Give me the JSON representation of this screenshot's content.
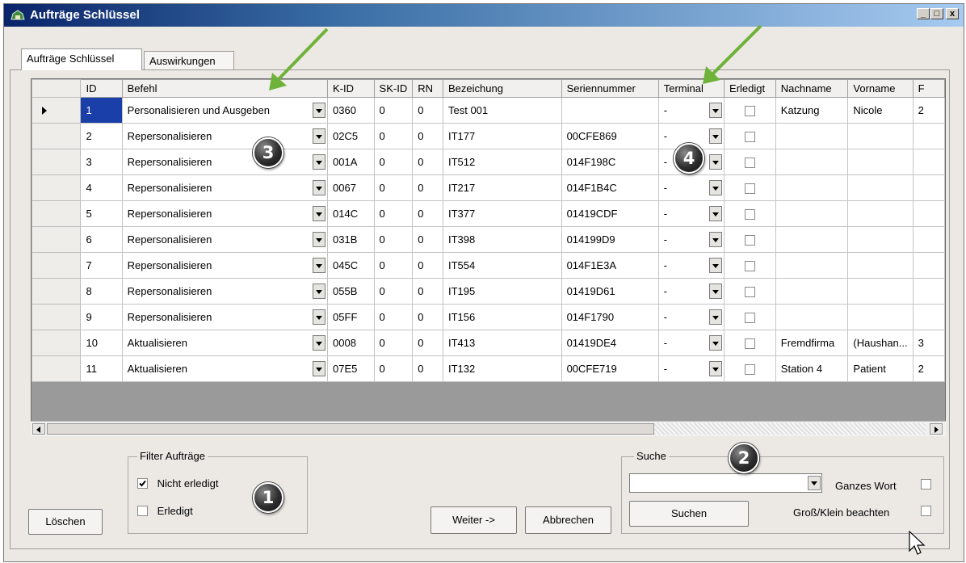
{
  "window": {
    "title": "Aufträge Schlüssel",
    "controls": {
      "minimize": "_",
      "maximize": "□",
      "close": "x"
    }
  },
  "tabs": [
    {
      "label": "Aufträge Schlüssel",
      "active": true
    },
    {
      "label": "Auswirkungen",
      "active": false
    }
  ],
  "grid": {
    "columns": [
      "ID",
      "Befehl",
      "K-ID",
      "SK-ID",
      "RN",
      "Bezeichung",
      "Seriennummer",
      "Terminal",
      "Erledigt",
      "Nachname",
      "Vorname",
      "F"
    ],
    "rows": [
      {
        "id": "1",
        "befehl": "Personalisieren und Ausgeben",
        "kid": "0360",
        "skid": "0",
        "rn": "0",
        "bez": "Test 001",
        "serial": "",
        "terminal": "-",
        "erledigt": false,
        "nachname": "Katzung",
        "vorname": "Nicole",
        "f": "2",
        "current": true
      },
      {
        "id": "2",
        "befehl": "Repersonalisieren",
        "kid": "02C5",
        "skid": "0",
        "rn": "0",
        "bez": "IT177",
        "serial": "00CFE869",
        "terminal": "-",
        "erledigt": false,
        "nachname": "",
        "vorname": "",
        "f": ""
      },
      {
        "id": "3",
        "befehl": "Repersonalisieren",
        "kid": "001A",
        "skid": "0",
        "rn": "0",
        "bez": "IT512",
        "serial": "014F198C",
        "terminal": "-",
        "erledigt": false,
        "nachname": "",
        "vorname": "",
        "f": ""
      },
      {
        "id": "4",
        "befehl": "Repersonalisieren",
        "kid": "0067",
        "skid": "0",
        "rn": "0",
        "bez": "IT217",
        "serial": "014F1B4C",
        "terminal": "-",
        "erledigt": false,
        "nachname": "",
        "vorname": "",
        "f": ""
      },
      {
        "id": "5",
        "befehl": "Repersonalisieren",
        "kid": "014C",
        "skid": "0",
        "rn": "0",
        "bez": "IT377",
        "serial": "01419CDF",
        "terminal": "-",
        "erledigt": false,
        "nachname": "",
        "vorname": "",
        "f": ""
      },
      {
        "id": "6",
        "befehl": "Repersonalisieren",
        "kid": "031B",
        "skid": "0",
        "rn": "0",
        "bez": "IT398",
        "serial": "014199D9",
        "terminal": "-",
        "erledigt": false,
        "nachname": "",
        "vorname": "",
        "f": ""
      },
      {
        "id": "7",
        "befehl": "Repersonalisieren",
        "kid": "045C",
        "skid": "0",
        "rn": "0",
        "bez": "IT554",
        "serial": "014F1E3A",
        "terminal": "-",
        "erledigt": false,
        "nachname": "",
        "vorname": "",
        "f": ""
      },
      {
        "id": "8",
        "befehl": "Repersonalisieren",
        "kid": "055B",
        "skid": "0",
        "rn": "0",
        "bez": "IT195",
        "serial": "01419D61",
        "terminal": "-",
        "erledigt": false,
        "nachname": "",
        "vorname": "",
        "f": ""
      },
      {
        "id": "9",
        "befehl": "Repersonalisieren",
        "kid": "05FF",
        "skid": "0",
        "rn": "0",
        "bez": "IT156",
        "serial": "014F1790",
        "terminal": "-",
        "erledigt": false,
        "nachname": "",
        "vorname": "",
        "f": ""
      },
      {
        "id": "10",
        "befehl": "Aktualisieren",
        "kid": "0008",
        "skid": "0",
        "rn": "0",
        "bez": "IT413",
        "serial": "01419DE4",
        "terminal": "-",
        "erledigt": false,
        "nachname": "Fremdfirma",
        "vorname": "(Haushan...",
        "f": "3"
      },
      {
        "id": "11",
        "befehl": "Aktualisieren",
        "kid": "07E5",
        "skid": "0",
        "rn": "0",
        "bez": "IT132",
        "serial": "00CFE719",
        "terminal": "-",
        "erledigt": false,
        "nachname": "Station 4",
        "vorname": "Patient",
        "f": "2"
      }
    ]
  },
  "filter": {
    "label": "Filter Aufträge",
    "not_done": {
      "label": "Nicht erledigt",
      "checked": true
    },
    "done": {
      "label": "Erledigt",
      "checked": false
    }
  },
  "search": {
    "label": "Suche",
    "value": "",
    "whole_word": {
      "label": "Ganzes Wort",
      "checked": false
    },
    "case_sensitive": {
      "label": "Groß/Klein beachten",
      "checked": false
    },
    "button": "Suchen"
  },
  "buttons": {
    "delete": "Löschen",
    "next": "Weiter ->",
    "cancel": "Abbrechen"
  },
  "annotations": {
    "badge1": "1",
    "badge2": "2",
    "badge3": "3",
    "badge4": "4"
  },
  "colors": {
    "arrow": "#6fb23a",
    "selection": "#1a3fa8",
    "title_start": "#0a246a"
  }
}
